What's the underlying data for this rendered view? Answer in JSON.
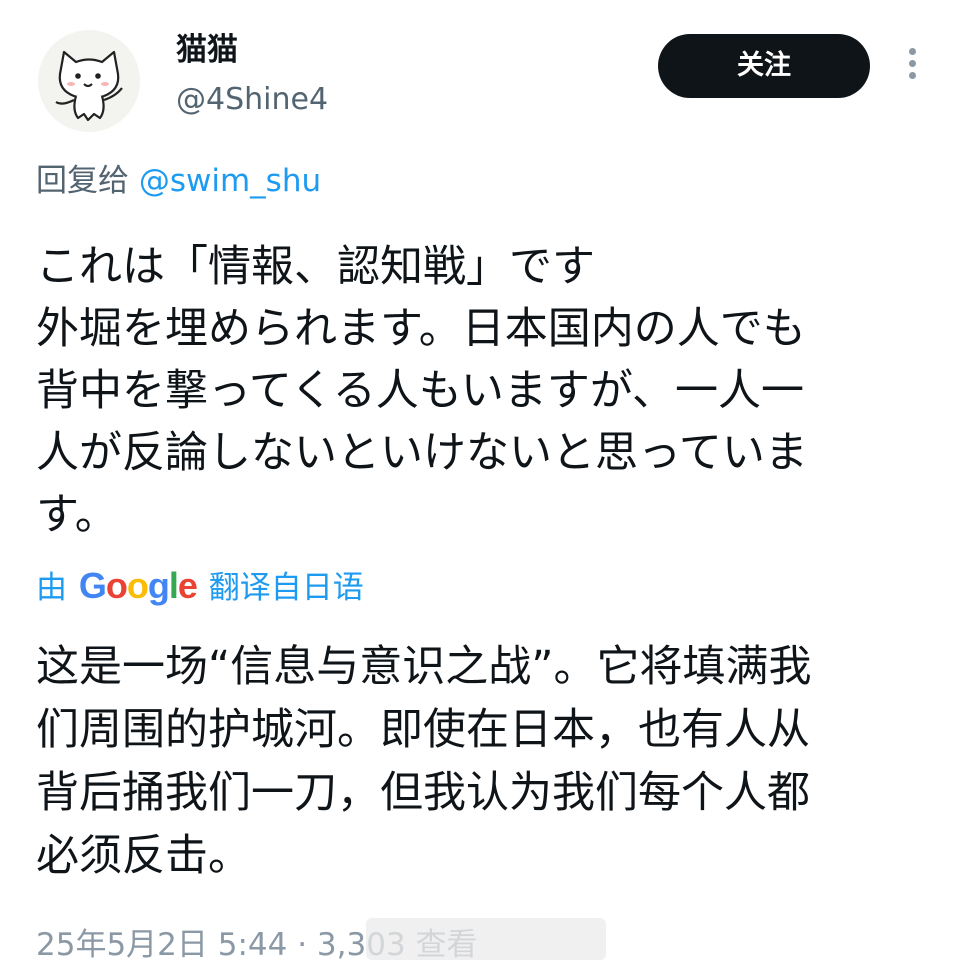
{
  "user": {
    "display_name": "猫猫",
    "handle": "@4Shine4",
    "avatar": "cartoon-cat-avatar"
  },
  "follow_button": {
    "label": "关注"
  },
  "reply": {
    "prefix": "回复给 ",
    "mention": "@swim_shu"
  },
  "tweet": {
    "lines": [
      "これは「情報、認知戦」です",
      "外堀を埋められます。日本国内の人でも",
      "背中を撃ってくる人もいますが、一人一",
      "人が反論しないといけないと思っていま",
      "す。"
    ]
  },
  "translation": {
    "by": "由",
    "service": "Google",
    "label": "翻译自日语",
    "lines": [
      "这是一场“信息与意识之战”。它将填满我",
      "们周围的护城河。即使在日本，也有人从",
      "背后捅我们一刀，但我认为我们每个人都",
      "必须反击。"
    ]
  },
  "meta": {
    "timestamp": "25年5月2日 5:44 · 3,303 查看"
  },
  "colors": {
    "accent": "#1d9bf0",
    "text": "#0f1419",
    "secondary": "#536471",
    "follow_bg": "#0f1419",
    "google_blue": "#4285f4",
    "google_red": "#ea4335",
    "google_yellow": "#fbbc05",
    "google_green": "#34a853"
  }
}
